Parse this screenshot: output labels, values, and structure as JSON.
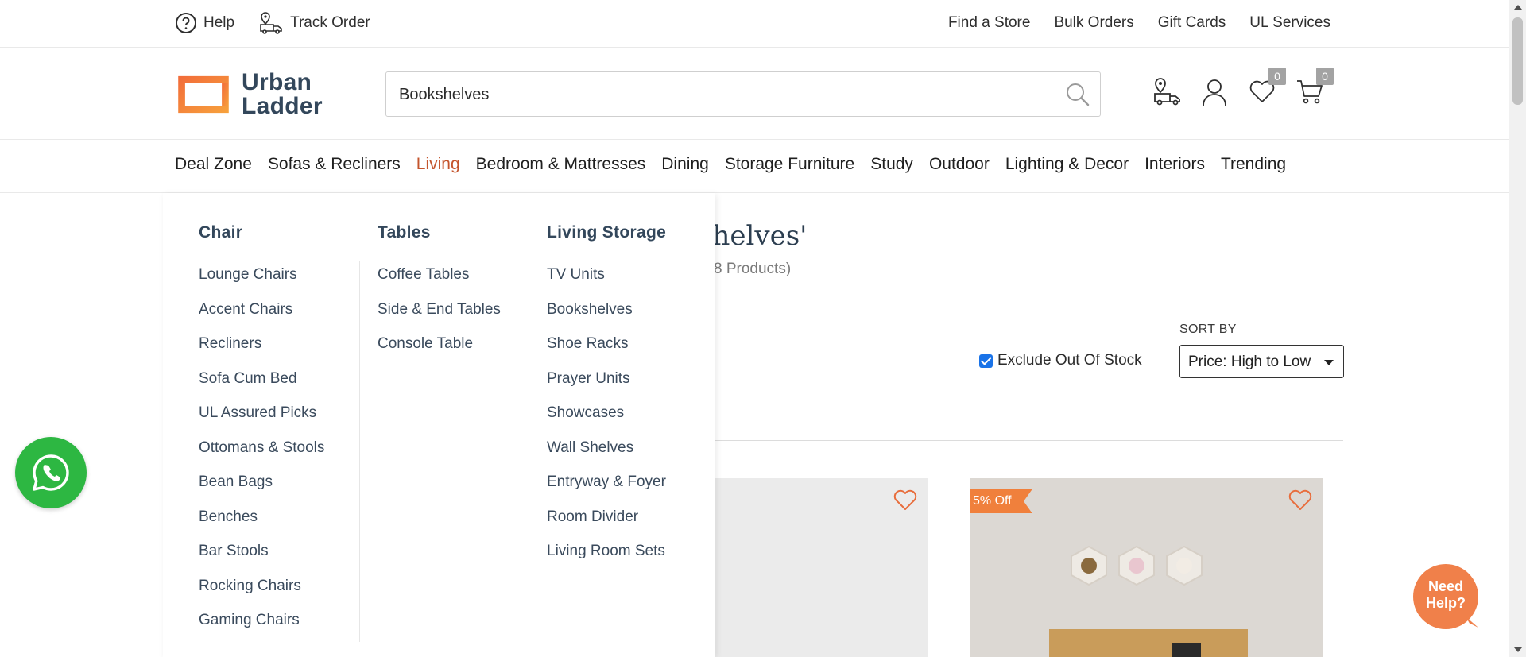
{
  "topbar": {
    "help_label": "Help",
    "track_order_label": "Track Order",
    "links": [
      "Find a Store",
      "Bulk Orders",
      "Gift Cards",
      "UL Services"
    ]
  },
  "header": {
    "logo_line1": "Urban",
    "logo_line2": "Ladder",
    "search_value": "Bookshelves",
    "wishlist_count": "0",
    "cart_count": "0"
  },
  "nav": {
    "items": [
      "Deal Zone",
      "Sofas & Recliners",
      "Living",
      "Bedroom & Mattresses",
      "Dining",
      "Storage Furniture",
      "Study",
      "Outdoor",
      "Lighting & Decor",
      "Interiors",
      "Trending"
    ],
    "active": "Living"
  },
  "mega_menu": {
    "columns": [
      {
        "heading": "Chair",
        "items": [
          "Lounge Chairs",
          "Accent Chairs",
          "Recliners",
          "Sofa Cum Bed",
          "UL Assured Picks",
          "Ottomans & Stools",
          "Bean Bags",
          "Benches",
          "Bar Stools",
          "Rocking Chairs",
          "Gaming Chairs"
        ]
      },
      {
        "heading": "Tables",
        "items": [
          "Coffee Tables",
          "Side & End Tables",
          "Console Table"
        ]
      },
      {
        "heading": "Living Storage",
        "items": [
          "TV Units",
          "Bookshelves",
          "Shoe Racks",
          "Prayer Units",
          "Showcases",
          "Wall Shelves",
          "Entryway & Foyer",
          "Room Divider",
          "Living Room Sets"
        ]
      }
    ]
  },
  "results": {
    "title_visible": "ts For 'Bookshelves'",
    "count_visible": "8 Products)",
    "exclude_out_of_stock_label": "Exclude Out Of Stock",
    "exclude_out_of_stock_checked": true,
    "sort_label": "SORT BY",
    "sort_value": "Price: High to Low"
  },
  "products": [
    {
      "discount_badge": ""
    },
    {
      "discount_badge": "5% Off"
    }
  ],
  "widgets": {
    "need_help_line1": "Need",
    "need_help_line2": "Help?"
  },
  "colors": {
    "brand_orange": "#f0803c",
    "nav_active": "#c4552d",
    "brand_navy": "#33475b",
    "whatsapp_green": "#2db742"
  }
}
